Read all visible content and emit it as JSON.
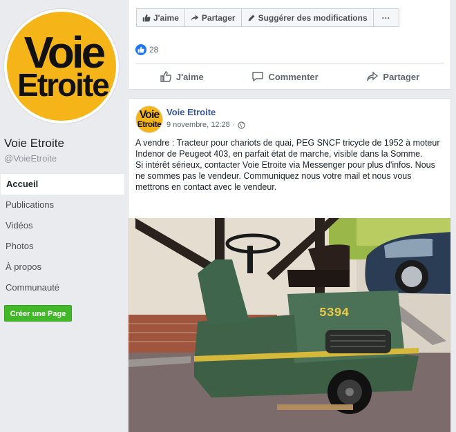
{
  "sidebar": {
    "logo_line1": "Voie",
    "logo_line2": "Etroite",
    "page_name": "Voie Etroite",
    "page_handle": "@VoieEtroite",
    "nav": [
      {
        "label": "Accueil",
        "active": true
      },
      {
        "label": "Publications",
        "active": false
      },
      {
        "label": "Vidéos",
        "active": false
      },
      {
        "label": "Photos",
        "active": false
      },
      {
        "label": "À propos",
        "active": false
      },
      {
        "label": "Communauté",
        "active": false
      }
    ],
    "create_page_label": "Créer une Page"
  },
  "page_actions": {
    "like": "J'aime",
    "share": "Partager",
    "suggest": "Suggérer des modifications",
    "more": "···"
  },
  "previous_post": {
    "like_count": "28",
    "like_label": "J'aime",
    "comment_label": "Commenter",
    "share_label": "Partager"
  },
  "post": {
    "author": "Voie Etroite",
    "avatar_line1": "Voie",
    "avatar_line2": "Etroite",
    "date": "9 novembre, 12:28",
    "dot": "·",
    "paragraph1": "A vendre : Tracteur pour chariots de quai, PEG SNCF tricycle de 1952 à moteur Indenor de Peugeot 403, en parfait état de marche, visible dans la Somme.",
    "paragraph2": "Si intérêt sérieux, contacter Voie Etroite via Messenger pour plus d'infos. Nous ne sommes pas le vendeur. Communiquez nous votre mail et nous vous mettrons en contact avec le vendeur.",
    "image_number": "5394"
  },
  "colors": {
    "facebook_blue": "#365899",
    "like_blue": "#2078f4",
    "green_button": "#42b72a",
    "logo_yellow": "#f5b519"
  }
}
